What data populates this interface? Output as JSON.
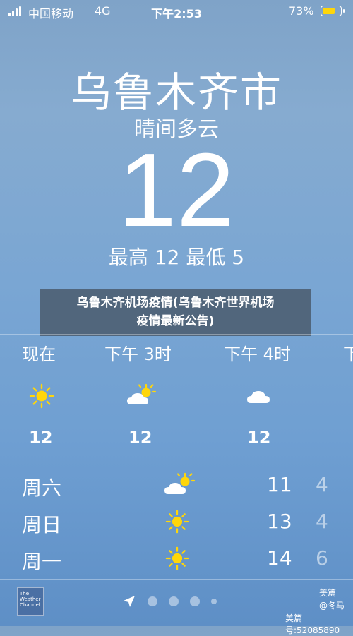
{
  "status": {
    "carrier": "中国移动",
    "network": "4G",
    "time": "下午2:53",
    "battery_pct": "73%",
    "battery_level": 0.73,
    "battery_color": "#ffd60a"
  },
  "current": {
    "city": "乌鲁木齐市",
    "condition": "晴间多云",
    "temp": "12",
    "hilo": "最高 12  最低 5"
  },
  "banner": {
    "line1": "乌鲁木齐机场疫情(乌鲁木齐世界机场",
    "line2": "疫情最新公告)"
  },
  "hourly": [
    {
      "label": "现在",
      "icon": "sun-icon",
      "temp": "12"
    },
    {
      "label": "下午 3时",
      "icon": "partly-cloudy-icon",
      "temp": "12"
    },
    {
      "label": "下午 4时",
      "icon": "cloud-icon",
      "temp": "12"
    },
    {
      "label": "下"
    }
  ],
  "daily": [
    {
      "day": "周六",
      "icon": "partly-cloudy-icon",
      "hi": "11",
      "lo": "4"
    },
    {
      "day": "周日",
      "icon": "sun-icon",
      "hi": "13",
      "lo": "4"
    },
    {
      "day": "周一",
      "icon": "sun-icon",
      "hi": "14",
      "lo": "6"
    }
  ],
  "footer": {
    "logo_line1": "The",
    "logo_line2": "Weather",
    "logo_line3": "Channel",
    "watermark1": "美篇",
    "watermark2": "@冬马",
    "watermark3": "美篇号:52085890"
  },
  "colors": {
    "sun": "#ffd60a"
  }
}
